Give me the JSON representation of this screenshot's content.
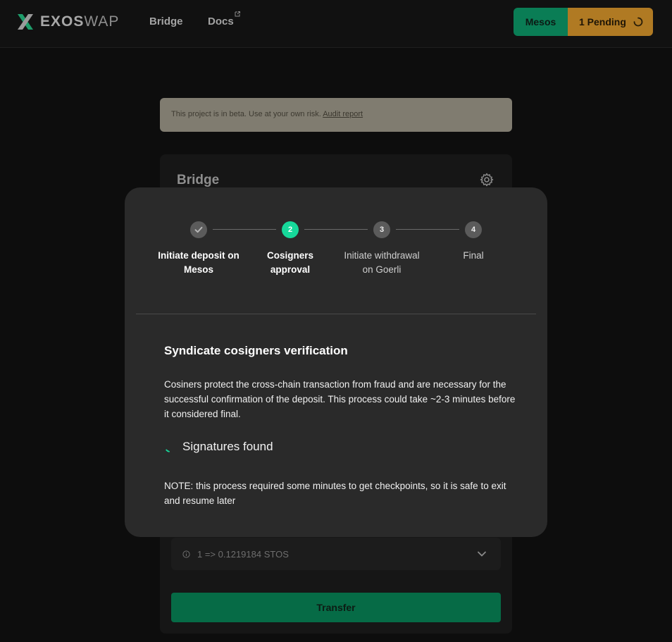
{
  "header": {
    "logo_bold": "EXOS",
    "logo_light": "WAP",
    "nav": [
      {
        "label": "Bridge"
      },
      {
        "label": "Docs"
      }
    ],
    "network_button": "Mesos",
    "pending_button": "1 Pending"
  },
  "banner": {
    "text": "This project is in beta. Use at your own risk.",
    "link": "Audit report"
  },
  "card": {
    "title": "Bridge",
    "rate": "1 => 0.1219184 STOS",
    "transfer_label": "Transfer"
  },
  "modal": {
    "steps": [
      {
        "number": "",
        "label": "Initiate deposit on Mesos",
        "status": "done"
      },
      {
        "number": "2",
        "label": "Cosigners approval",
        "status": "active"
      },
      {
        "number": "3",
        "label": "Initiate withdrawal on Goerli",
        "status": "todo"
      },
      {
        "number": "4",
        "label": "Final",
        "status": "todo"
      }
    ],
    "title": "Syndicate cosigners verification",
    "description": "Cosiners protect the cross-chain transaction from fraud and are necessary for the successful confirmation of the deposit. This process could take ~2-3 minutes before it considered final.",
    "signatures_text": "Signatures found",
    "note": "NOTE: this process required some minutes to get checkpoints, so it is safe to exit and resume later"
  },
  "colors": {
    "accent_green": "#16d89a",
    "mesos_button": "#0a7d55",
    "pending_button": "#b07a23",
    "modal_bg": "#2a2a2a"
  }
}
